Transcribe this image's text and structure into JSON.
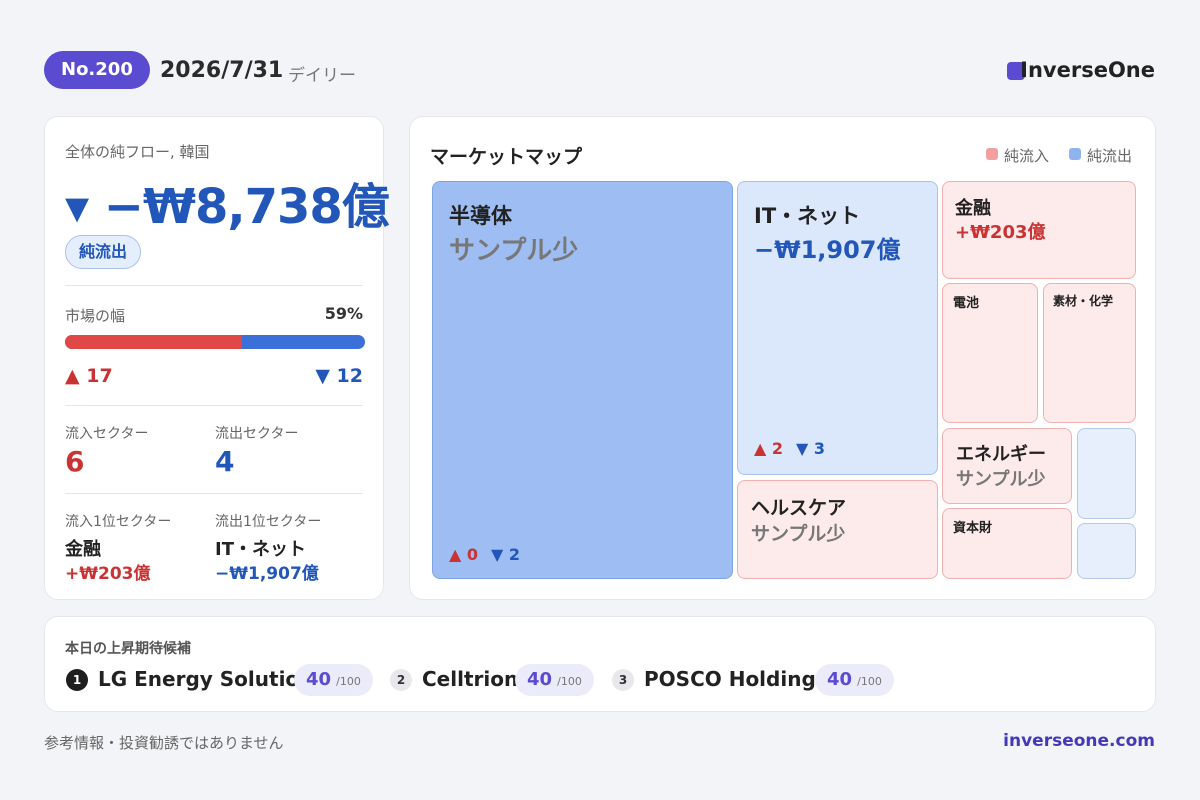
{
  "header": {
    "badge": "No.200",
    "date": "2026/7/31",
    "period": "デイリー",
    "brand": "InverseOne",
    "brand_color": "#5b4bd1"
  },
  "summary": {
    "label": "全体の純フロー, 韓国",
    "value": "▾ −₩8,738億",
    "pill": "純流出"
  },
  "breadth": {
    "label": "市場の幅",
    "percent": "59%",
    "fill_fraction": 0.59,
    "up": "▲ 17",
    "down": "▼ 12"
  },
  "sectors": {
    "inflow_label": "流入セクター",
    "inflow_count": "6",
    "outflow_label": "流出セクター",
    "outflow_count": "4",
    "top_inflow_label": "流入1位セクター",
    "top_inflow_name": "金融",
    "top_inflow_value": "+₩203億",
    "top_outflow_label": "流出1位セクター",
    "top_outflow_name": "IT・ネット",
    "top_outflow_value": "−₩1,907億"
  },
  "market_map": {
    "title": "マーケットマップ",
    "legend_inflow": "純流入",
    "legend_outflow": "純流出",
    "inflow_color": "#f3a0a0",
    "outflow_color": "#8fb3ee",
    "tiles": {
      "semiconductor": {
        "name": "半導体",
        "value": "サンプル少",
        "up": "▲ 0",
        "down": "▼ 2"
      },
      "it": {
        "name": "IT・ネット",
        "value": "−₩1,907億",
        "up": "▲ 2",
        "down": "▼ 3"
      },
      "healthcare": {
        "name": "ヘルスケア",
        "value": "サンプル少"
      },
      "finance": {
        "name": "金融",
        "value": "+₩203億"
      },
      "battery": {
        "name": "電池"
      },
      "materials": {
        "name": "素材・化学"
      },
      "energy": {
        "name": "エネルギー",
        "value": "サンプル少"
      },
      "capital_goods": {
        "name": "資本財"
      }
    }
  },
  "candidates": {
    "title": "本日の上昇期待候補",
    "items": [
      {
        "rank": "1",
        "name": "LG Energy Solution",
        "score": "40",
        "max": "/100"
      },
      {
        "rank": "2",
        "name": "Celltrion",
        "score": "40",
        "max": "/100"
      },
      {
        "rank": "3",
        "name": "POSCO Holdings",
        "score": "40",
        "max": "/100"
      }
    ]
  },
  "footer": {
    "disclaimer": "参考情報・投資勧誘ではありません",
    "site": "inverseone.com"
  }
}
